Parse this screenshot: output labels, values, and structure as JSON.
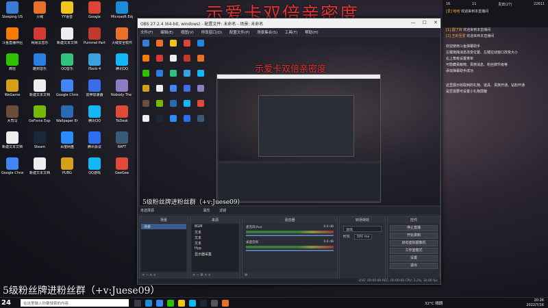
{
  "banner": {
    "top_text": "示爱卡双倍亲密度",
    "bottom_text": "5级粉丝牌进粉丝群（+v:Juese09）",
    "preview_top_text": "示爱卡双倍亲密度",
    "preview_bottom_text": "5级粉丝牌进粉丝群（+v:Juese09）"
  },
  "desktop_icons": [
    {
      "label": "Sleeping US",
      "color": "#3a7bd5"
    },
    {
      "label": "火绒",
      "color": "#e8702a"
    },
    {
      "label": "YY语音",
      "color": "#f0c419"
    },
    {
      "label": "Google",
      "color": "#db4437"
    },
    {
      "label": "Microsoft Edge",
      "color": "#1d8bd8"
    },
    {
      "label": "斗鱼直播伴侣",
      "color": "#f57c00"
    },
    {
      "label": "网易云音乐",
      "color": "#d33a31"
    },
    {
      "label": "新建文本文档",
      "color": "#eeeeee"
    },
    {
      "label": "Pummel Party",
      "color": "#c0392b"
    },
    {
      "label": "火绒安全软件",
      "color": "#e8702a"
    },
    {
      "label": "微信",
      "color": "#2dc100"
    },
    {
      "label": "酷狗音乐",
      "color": "#2a7de1"
    },
    {
      "label": "QQ音乐",
      "color": "#31c27c"
    },
    {
      "label": "iTools 4",
      "color": "#3aa0e0"
    },
    {
      "label": "腾讯QQ",
      "color": "#12b7f5"
    },
    {
      "label": "WeGame",
      "color": "#d4a017"
    },
    {
      "label": "新建文本文档",
      "color": "#eeeeee"
    },
    {
      "label": "Google Chrome",
      "color": "#4285f4"
    },
    {
      "label": "雷神加速器",
      "color": "#3a6ee8"
    },
    {
      "label": "Nobody The Turna...",
      "color": "#8e7cc3"
    },
    {
      "label": "大司马",
      "color": "#6a4d3a"
    },
    {
      "label": "GeForce Experience",
      "color": "#76b900"
    },
    {
      "label": "Wallpaper Engine",
      "color": "#2a6ab2"
    },
    {
      "label": "腾讯QQ",
      "color": "#12b7f5"
    },
    {
      "label": "ToDesk",
      "color": "#e04a3a"
    },
    {
      "label": "新建文本文档",
      "color": "#eeeeee"
    },
    {
      "label": "Steam",
      "color": "#1b2838"
    },
    {
      "label": "百度网盘",
      "color": "#2a8cff"
    },
    {
      "label": "腾讯会议",
      "color": "#2b6ef0"
    },
    {
      "label": "RAFT",
      "color": "#3a5a7a"
    },
    {
      "label": "Google Chrome",
      "color": "#4285f4"
    },
    {
      "label": "新建文本文档",
      "color": "#eeeeee"
    },
    {
      "label": "PUBG",
      "color": "#d4a017"
    },
    {
      "label": "QQ游戏",
      "color": "#12b7f5"
    },
    {
      "label": "GeeGee",
      "color": "#e04a3a"
    }
  ],
  "obs": {
    "title": "OBS 27.2.4 (64-bit, windows) - 配置文件: 未命名 - 场景: 未命名",
    "window_controls": [
      "—",
      "☐",
      "✕"
    ],
    "menu": [
      "文件(F)",
      "编辑(E)",
      "视图(V)",
      "停靠窗口(D)",
      "配置文件(P)",
      "场景集合(S)",
      "工具(T)",
      "帮助(H)"
    ],
    "scene_bar_label": "未选择源",
    "scene_bar_btns": [
      "属性",
      "滤镜"
    ],
    "docks": {
      "scenes": {
        "title": "场景",
        "items": [
          "场景"
        ]
      },
      "sources": {
        "title": "来源",
        "items": [
          "BGM",
          "文本",
          "文本",
          "文本",
          "Hyp",
          "显示器采集"
        ]
      },
      "mixer": {
        "title": "混音器",
        "channels": [
          {
            "name": "麦克风/Aux",
            "level": "0.0 dB"
          },
          {
            "name": "桌面音频",
            "level": "0.0 dB"
          }
        ]
      },
      "transitions": {
        "title": "转场特效",
        "type": "淡出",
        "duration_label": "时长",
        "duration": "300 ms"
      },
      "controls": {
        "title": "控件",
        "buttons": [
          "停止直播",
          "开始录制",
          "启动虚拟摄像机",
          "工作室模式",
          "设置",
          "退出"
        ]
      }
    },
    "status": "LIVE: 00:00:00   REC: 00:00:00   CPU: 3.2%, 30.00 fps"
  },
  "chat": {
    "stats": [
      "16",
      "11",
      "贵宾(27)",
      "22611"
    ],
    "messages": [
      {
        "name": "[爱] 哈哈",
        "text": "欢迎来到本直播间"
      },
      {
        "name": "[1] 圆了妳",
        "text": "欢迎来到本直播间"
      },
      {
        "name": "[2] 王的至爱",
        "text": "欢迎来到本直播间"
      }
    ],
    "notice_lines": [
      "欢迎使用斗鱼弹幕助手",
      "左键拖拽消息改变位置、左键拉动窗口改变大小",
      "右上角有设置菜单",
      "可隐藏贡献榜、贵族消息、粉丝牌升级等",
      "添加弹幕助手成功",
      "",
      "这里展示收取到的礼物、道具、贵族开通、钻粉开通",
      "是否需要可设置小礼物屏蔽"
    ]
  },
  "taskbar": {
    "start_label": "24",
    "search_placeholder": "在这里输入你要搜索的内容",
    "weather": "32°C 晴朗",
    "time": "20:26",
    "date": "2022/7/16"
  }
}
